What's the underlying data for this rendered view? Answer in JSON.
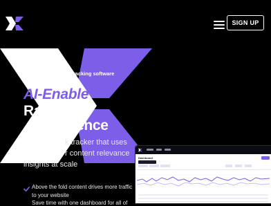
{
  "header": {
    "logo_icon": "x-logo-icon",
    "menu_icon": "hamburger-menu-icon",
    "signup_label": "SIGN UP"
  },
  "hero": {
    "eyebrow": "k tracking software",
    "headline_line1": "AI-Enable",
    "headline_line2": "Ra",
    "headline_line3": "ence",
    "paragraph_line1": "k tracker that uses",
    "paragraph_line2": "r content relevance",
    "paragraph_line3": "insights at scale"
  },
  "bullets": [
    {
      "icon": "check-icon",
      "line1": "Above the fold content drives more traffic",
      "line2": "to your website"
    },
    {
      "icon": "check-icon",
      "line1": "Save time with one dashboard for all of"
    }
  ],
  "dashboard": {
    "title": "Dashboard"
  },
  "colors": {
    "background": "#000000",
    "accent": "#7c5ee8",
    "text": "#ffffff"
  }
}
